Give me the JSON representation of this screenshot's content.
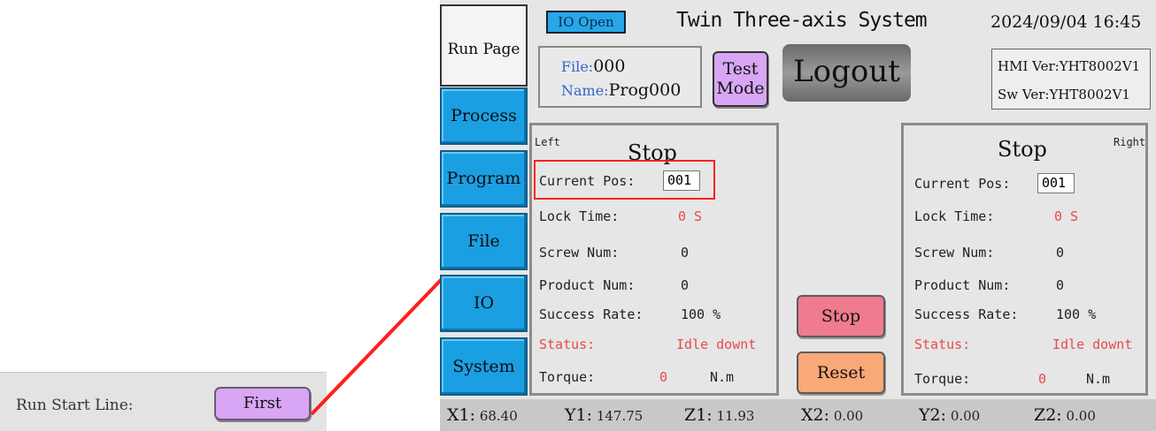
{
  "inset": {
    "label": "Run Start Line:",
    "button_label": "First"
  },
  "nav": {
    "items": [
      {
        "label": "Run Page",
        "active": true
      },
      {
        "label": "Process"
      },
      {
        "label": "Program"
      },
      {
        "label": "File"
      },
      {
        "label": "IO"
      },
      {
        "label": "System"
      }
    ]
  },
  "header": {
    "io_open": "IO Open",
    "title": "Twin Three-axis System",
    "datetime": "2024/09/04 16:45",
    "file_key": "File:",
    "file_val": "000",
    "name_key": "Name:",
    "name_val": "Prog000",
    "test_mode": "Test Mode",
    "logout": "Logout",
    "hmi_ver": "HMI Ver:YHT8002V1",
    "sw_ver": "Sw Ver:YHT8002V1"
  },
  "left": {
    "side": "Left",
    "state": "Stop",
    "current_pos_label": "Current Pos:",
    "current_pos": "001",
    "lock_time_label": "Lock Time:",
    "lock_time": "0 S",
    "screw_num_label": "Screw Num:",
    "screw_num": "0",
    "product_num_label": "Product Num:",
    "product_num": "0",
    "success_rate_label": "Success Rate:",
    "success_rate": "100 %",
    "status_label": "Status:",
    "status": "Idle downt",
    "torque_label": "Torque:",
    "torque": "0",
    "torque_unit": "N.m"
  },
  "right": {
    "side": "Right",
    "state": "Stop",
    "current_pos_label": "Current Pos:",
    "current_pos": "001",
    "lock_time_label": "Lock Time:",
    "lock_time": "0 S",
    "screw_num_label": "Screw Num:",
    "screw_num": "0",
    "product_num_label": "Product Num:",
    "product_num": "0",
    "success_rate_label": "Success Rate:",
    "success_rate": "100 %",
    "status_label": "Status:",
    "status": "Idle downt",
    "torque_label": "Torque:",
    "torque": "0",
    "torque_unit": "N.m"
  },
  "controls": {
    "stop": "Stop",
    "reset": "Reset"
  },
  "coords": [
    {
      "axis": "X1:",
      "value": "68.40"
    },
    {
      "axis": "Y1:",
      "value": "147.75"
    },
    {
      "axis": "Z1:",
      "value": "11.93"
    },
    {
      "axis": "X2:",
      "value": "0.00"
    },
    {
      "axis": "Y2:",
      "value": "0.00"
    },
    {
      "axis": "Z2:",
      "value": "0.00"
    }
  ],
  "colors": {
    "nav_blue": "#1a9fe3",
    "highlight_red": "#ff1f1f",
    "button_purple": "#d8a6f4",
    "stop_pink": "#f07a8e",
    "reset_orange": "#f9a878"
  }
}
